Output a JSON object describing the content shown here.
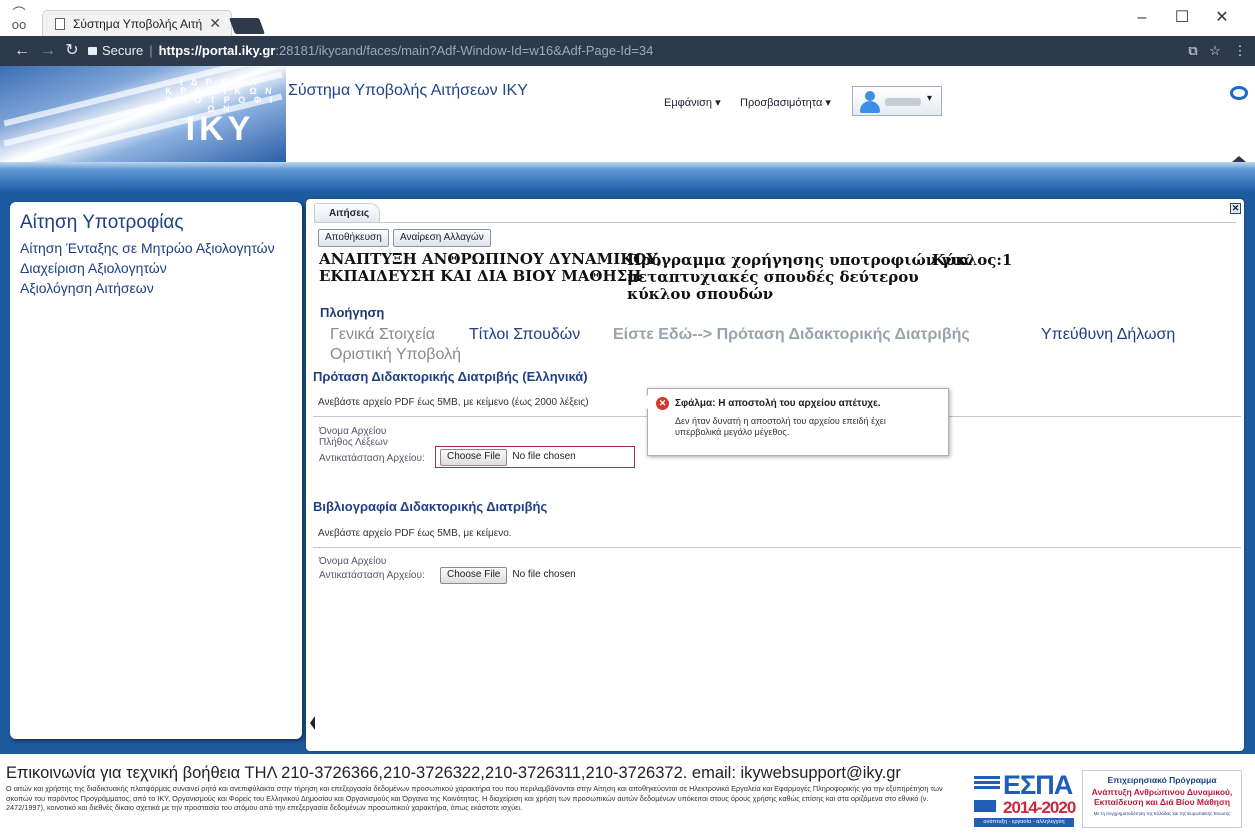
{
  "browser": {
    "tab_title": "Σύστημα Υποβολής Αιτή",
    "secure_label": "Secure",
    "url_host": "https://portal.iky.gr",
    "url_path": ":28181/ikycand/faces/main?Adf-Window-Id=w16&Adf-Page-Id=34",
    "window_controls": {
      "minimize": "–",
      "maximize": "☐",
      "close": "✕"
    }
  },
  "header": {
    "logo_small_text": "Ι Δ Ρ Υ Μ Α\nΚ Ρ Α Τ Ι Κ Ω Ν\nΥ Π Ο Τ Ρ Ο Φ Ι Ω Ν",
    "logo_big_text": "ΙΚΥ",
    "app_title": "Σύστημα Υποβολής Αιτήσεων ΙΚΥ",
    "menu_view": "Εμφάνιση ▾",
    "menu_accessibility": "Προσβασιμότητα ▾"
  },
  "sidebar": {
    "title": "Αίτηση Υποτροφίας",
    "items": [
      {
        "label": "Αίτηση Ένταξης σε Μητρώο Αξιολογητών"
      },
      {
        "label": "Διαχείριση Αξιολογητών"
      },
      {
        "label": "Αξιολόγηση Αιτήσεων"
      }
    ]
  },
  "main": {
    "tab_label": "Αιτήσεις",
    "save_button": "Αποθήκευση",
    "undo_button": "Αναίρεση Αλλαγών",
    "program_area_line1": "ΑΝΑΠΤΥΞΗ ΑΝΘΡΩΠΙΝΟΥ ΔΥΝΑΜΙΚΟΥ,",
    "program_area_line2": "ΕΚΠΑΙΔΕΥΣΗ ΚΑΙ ΔΙΑ ΒΙΟΥ ΜΑΘΗΣΗ",
    "program_line1": "Πρόγραμμα χορήγησης υποτροφιών για",
    "program_line2": "μεταπτυχιακές σπουδές δεύτερου",
    "program_line3": "κύκλου σπουδών",
    "cycle": "Κύκλος:1",
    "navigation_title": "Πλοήγηση",
    "nav": {
      "general": "Γενικά Στοιχεία",
      "titles": "Τίτλοι Σπουδών",
      "here": "Είστε Εδώ--> Πρόταση Διδακτορικής Διατριβής",
      "declaration": "Υπεύθυνη Δήλωση",
      "final": "Οριστική Υποβολή"
    },
    "section1": {
      "title": "Πρόταση Διδακτορικής Διατριβής (Ελληνικά)",
      "instructions": "Ανεβάστε αρχείο PDF έως 5MB, με κείμενο (έως 2000 λέξεις)",
      "filename_label": "Όνομα Αρχείου",
      "wordcount_label": "Πλήθος Λέξεων",
      "replace_label": "Αντικατάσταση Αρχείου:",
      "choose_file": "Choose File",
      "no_file": "No file chosen"
    },
    "section2": {
      "title": "Βιβλιογραφία Διδακτορικής Διατριβής",
      "instructions": "Ανεβάστε αρχείο PDF έως 5MB, με κείμενο.",
      "filename_label": "Όνομα Αρχείου",
      "replace_label": "Αντικατάσταση Αρχείου:",
      "choose_file": "Choose File",
      "no_file": "No file chosen"
    }
  },
  "error_popup": {
    "title": "Σφάλμα: Η αποστολή του αρχείου απέτυχε.",
    "message": "Δεν ήταν δυνατή η αποστολή του αρχείου επειδή έχει υπερβολικά μεγάλο μέγεθος."
  },
  "footer": {
    "contact": "Επικοινωνία για τεχνική βοήθεια ΤΗΛ 210-3726366,210-3726322,210-3726311,210-3726372. email: ikywebsupport@iky.gr",
    "legal": "Ο αιτών και χρήστης της διαδικτυακής πλατφόρμας συναινεί ρητά και ανεπιφύλακτα στην τήρηση και επεξεργασία δεδομένων προσωπικού χαρακτήρα του που περιλαμβάνονται στην Αίτηση και αποθηκεύονται σε Ηλεκτρονικά Εργαλεία και Εφαρμογές Πληροφορικής για την εξυπηρέτηση των σκοπών του παρόντος Προγράμματος, από το ΙΚΥ, Οργανισμούς και Φορείς του Ελληνικού Δημοσίου και Οργανισμούς και Όργανα της Κοινότητας. Η διαχείριση και χρήση των προσωπικών αυτών δεδομένων υπόκειται στους όρους χρήσης καθώς επίσης και στα οριζόμενα στο εθνικό (ν. 2472/1997), κοινοτικό και διεθνές δίκαιο σχετικά με την προστασία του ατόμου από την επεξεργασία δεδομένων προσωπικού χαρακτήρα, όπως εκάστοτε ισχύει.",
    "espa_word": "ΕΣΠΑ",
    "espa_years": "2014-2020",
    "espa_bar": "ανάπτυξη - εργασία - αλληλεγγύη",
    "op_line1": "Επιχειρησιακό Πρόγραμμα",
    "op_line2": "Ανάπτυξη Ανθρώπινου Δυναμικού, Εκπαίδευση και Διά Βίου Μάθηση",
    "op_line3": "Με τη συγχρηματοδότηση της Ελλάδας και της Ευρωπαϊκής Ένωσης"
  }
}
